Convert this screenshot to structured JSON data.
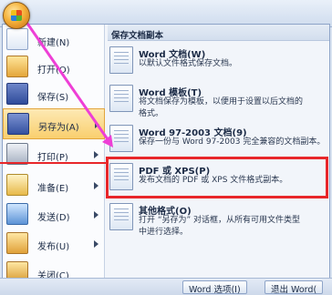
{
  "left_menu": [
    {
      "label": "新建(N)",
      "icon": "new-document-icon",
      "has_submenu": false
    },
    {
      "label": "打开(O)",
      "icon": "open-folder-icon",
      "has_submenu": false
    },
    {
      "label": "保存(S)",
      "icon": "save-icon",
      "has_submenu": false
    },
    {
      "label": "另存为(A)",
      "icon": "save-as-icon",
      "has_submenu": true,
      "selected": true
    },
    {
      "label": "打印(P)",
      "icon": "print-icon",
      "has_submenu": true
    },
    {
      "label": "准备(E)",
      "icon": "prepare-icon",
      "has_submenu": true
    },
    {
      "label": "发送(D)",
      "icon": "send-icon",
      "has_submenu": true
    },
    {
      "label": "发布(U)",
      "icon": "publish-icon",
      "has_submenu": true
    },
    {
      "label": "关闭(C)",
      "icon": "close-folder-icon",
      "has_submenu": false
    }
  ],
  "save_copy": {
    "title": "保存文档副本",
    "options": [
      {
        "title": "Word 文档(W)",
        "desc": [
          "以默认文件格式保存文档。"
        ]
      },
      {
        "title": "Word 模板(T)",
        "desc": [
          "将文档保存为模板，以便用于设置以后文档的",
          "格式。"
        ]
      },
      {
        "title": "Word 97-2003 文档(9)",
        "desc": [
          "保存一份与 Word 97-2003 完全兼容的文档副本。"
        ]
      },
      {
        "title": "PDF 或 XPS(P)",
        "desc": [
          "发布文档的 PDF 或 XPS 文件格式副本。"
        ]
      },
      {
        "title": "其他格式(O)",
        "desc": [
          "打开 “另存为” 对话框，从所有可用文件类型",
          "中进行选择。"
        ]
      }
    ]
  },
  "status": {
    "word_options": "Word 选项(I)",
    "exit_word": "退出 Word("
  },
  "colors": {
    "highlight": "#e8262a",
    "arrow": "#ee3fd6",
    "selected_bg": "#f9cf6e"
  }
}
